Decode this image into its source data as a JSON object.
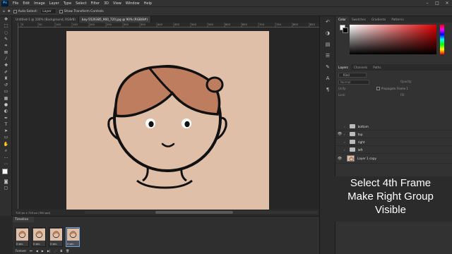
{
  "menubar": {
    "logo": "Ps",
    "items": [
      "File",
      "Edit",
      "Image",
      "Layer",
      "Type",
      "Select",
      "Filter",
      "3D",
      "View",
      "Window",
      "Help"
    ]
  },
  "options": {
    "auto_select_label": "Auto-Select:",
    "auto_select_value": "Layer",
    "transform_label": "Show Transform Controls"
  },
  "tabs": [
    {
      "label": "Untitled-1 @ 100% (Background, RGB/8)"
    },
    {
      "label": "boy-5526385_960_720.jpg @ 90% (RGB/8#)"
    }
  ],
  "ruler_ticks": [
    "0",
    "50",
    "100",
    "150",
    "200",
    "250",
    "300",
    "350",
    "400",
    "450",
    "500",
    "550",
    "600",
    "650",
    "700",
    "750",
    "800",
    "850"
  ],
  "statusbar": {
    "text": "720 px x 720 px (300 ppi)"
  },
  "timeline": {
    "title": "Timeline",
    "frames": [
      {
        "num": "1",
        "time": "0 sec."
      },
      {
        "num": "2",
        "time": "0 sec."
      },
      {
        "num": "3",
        "time": "0 sec."
      },
      {
        "num": "4",
        "time": "0 sec."
      }
    ],
    "loop": "Forever"
  },
  "right": {
    "color_tabs": [
      "Color",
      "Swatches",
      "Gradients",
      "Patterns"
    ],
    "layers_tabs": [
      "Layers",
      "Channels",
      "Paths"
    ],
    "kind_label": "Kind",
    "blend_mode": "Normal",
    "opacity_label": "Opacity:",
    "unify_label": "Unify:",
    "propagate_label": "Propagate Frame 1",
    "lock_label": "Lock:",
    "fill_label": "Fill:",
    "layers": [
      {
        "name": "bottom",
        "visible": true,
        "type": "folder"
      },
      {
        "name": "top",
        "visible": true,
        "type": "folder"
      },
      {
        "name": "right",
        "visible": false,
        "type": "folder"
      },
      {
        "name": "left",
        "visible": false,
        "type": "folder"
      },
      {
        "name": "Layer 1 copy",
        "visible": true,
        "type": "image"
      }
    ]
  },
  "note": {
    "line1": "Select 4th Frame",
    "line2": "Make Right Group",
    "line3": "Visible"
  },
  "colors": {
    "canvas_bg": "#e0bfa9",
    "hair": "#be7d5e",
    "outline": "#111111",
    "accent_select": "#6f9fd8"
  }
}
